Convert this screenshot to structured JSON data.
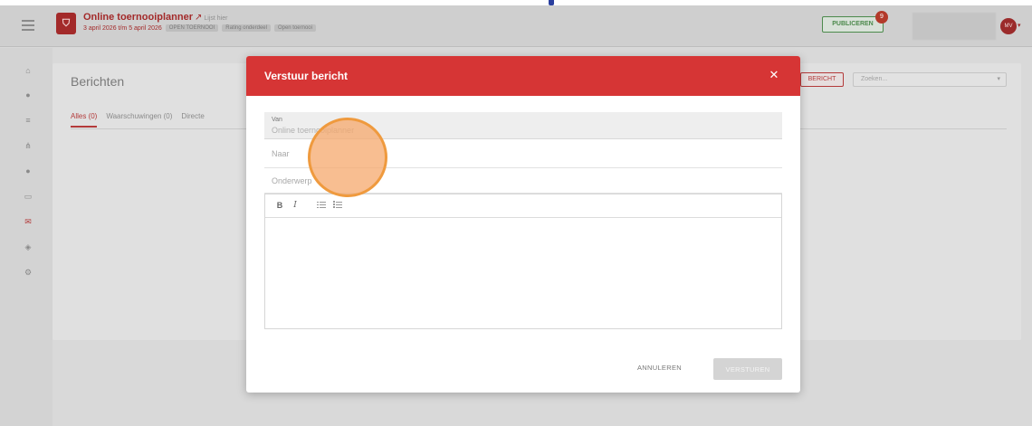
{
  "header": {
    "app_title": "Online toernooiplanner",
    "external_link_icon": "external-link-icon",
    "title_tag": "Lijst hier",
    "date_range": "3 april 2026 t/m 5 april 2026",
    "pills": [
      "OPEN TOERNOOI",
      "Rating onderdeel",
      "Open toernooi"
    ],
    "publish_label": "PUBLICEREN",
    "publish_badge": "9",
    "avatar_initials": "MV"
  },
  "sidebar": {
    "icons": [
      "home-icon",
      "users-icon",
      "list-icon",
      "tree-icon",
      "globe-icon",
      "monitor-icon",
      "mail-icon",
      "tag-icon",
      "gear-icon"
    ],
    "active": "mail-icon"
  },
  "page": {
    "title": "Berichten",
    "tabs": [
      "Alles (0)",
      "Waarschuwingen (0)",
      "Directe"
    ],
    "bericht_button": "BERICHT",
    "search_placeholder": "Zoeken..."
  },
  "modal": {
    "title": "Verstuur bericht",
    "close_icon": "close-icon",
    "van_label": "Van",
    "van_value": "Online toernooiplanner",
    "naar_placeholder": "Naar",
    "subject_placeholder": "Onderwerp",
    "toolbar": {
      "bold": "B",
      "italic": "I"
    },
    "cancel_label": "ANNULEREN",
    "send_label": "VERSTUREN"
  },
  "colors": {
    "accent_red": "#d63535",
    "publish_green": "#4c8a4c",
    "click_indicator": "#ef9a3e"
  }
}
